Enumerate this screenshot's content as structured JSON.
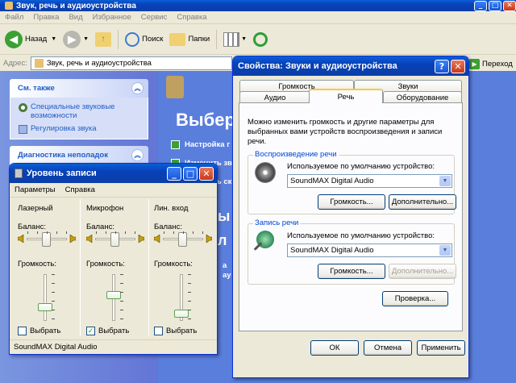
{
  "explorer": {
    "title": "Звук, речь и аудиоустройства",
    "menu": [
      "Файл",
      "Правка",
      "Вид",
      "Избранное",
      "Сервис",
      "Справка"
    ],
    "toolbar": {
      "back": "Назад",
      "search": "Поиск",
      "folders": "Папки"
    },
    "address_label": "Адрес:",
    "address_value": "Звук, речь и аудиоустройства",
    "go_label": "Переход",
    "see_also": {
      "title": "См. также",
      "links": [
        "Специальные звуковые возможности",
        "Регулировка звука"
      ]
    },
    "troubleshoot": {
      "title": "Диагностика неполадок"
    },
    "main_heading_partial": "Выбер",
    "tasks_partial": [
      "Настройка г",
      "Изменить зв",
      "Изменить ск"
    ],
    "icons_partial": [
      "ы",
      "л"
    ],
    "fragments": [
      "а",
      "ау"
    ]
  },
  "dialog": {
    "title": "Свойства: Звуки и аудиоустройства",
    "tabs_top": [
      "Громкость",
      "Звуки"
    ],
    "tabs_bottom": [
      "Аудио",
      "Речь",
      "Оборудование"
    ],
    "active_tab": "Речь",
    "description": "Можно изменить громкость и другие параметры для выбранных вами устройств воспроизведения и записи речи.",
    "playback": {
      "title": "Воспроизведение речи",
      "device_label": "Используемое по умолчанию устройство:",
      "device_value": "SoundMAX Digital Audio",
      "volume_button": "Громкость...",
      "advanced_button": "Дополнительно..."
    },
    "recording": {
      "title": "Запись речи",
      "device_label": "Используемое по умолчанию устройство:",
      "device_value": "SoundMAX Digital Audio",
      "volume_button": "Громкость...",
      "advanced_button": "Дополнительно..."
    },
    "test_button": "Проверка...",
    "ok": "ОК",
    "cancel": "Отмена",
    "apply": "Применить"
  },
  "recording_level": {
    "title": "Уровень записи",
    "menu": [
      "Параметры",
      "Справка"
    ],
    "balance_label": "Баланс:",
    "volume_label": "Громкость:",
    "select_label": "Выбрать",
    "channels": [
      {
        "name": "Лазерный",
        "balance": 0.5,
        "volume": 0.3,
        "selected": false
      },
      {
        "name": "Микрофон",
        "balance": 0.5,
        "volume": 0.55,
        "selected": true
      },
      {
        "name": "Лин. вход",
        "balance": 0.5,
        "volume": 0.15,
        "selected": false
      }
    ],
    "status": "SoundMAX Digital Audio"
  },
  "colors": {
    "xp_title": "#0A5FD8",
    "task_pane_link": "#215DC6",
    "group_title": "#0046D5",
    "check": "#21A121"
  }
}
